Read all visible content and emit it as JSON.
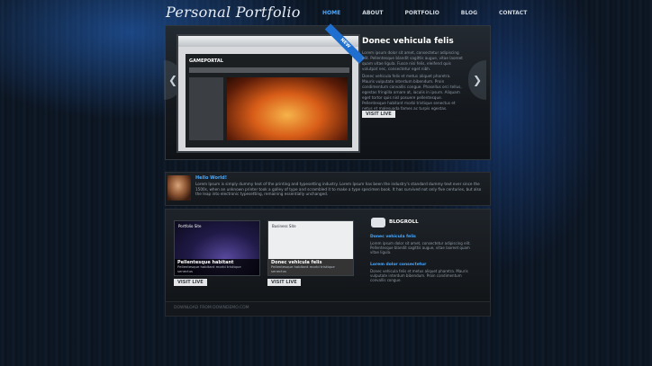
{
  "site": {
    "logo": "Personal Portfolio"
  },
  "nav": {
    "items": [
      "HOME",
      "ABOUT",
      "PORTFOLIO",
      "BLOG",
      "CONTACT"
    ],
    "active": "HOME"
  },
  "featured": {
    "ribbon": "NEW",
    "screenshot_logo": "GAMEPORTAL",
    "title": "Donec vehicula felis",
    "paragraph1": "Lorem ipsum dolor sit amet, consectetur adipiscing elit. Pellentesque blandit sagittis augue, vitae laoreet quam vitae ligula. Fusce nisi felis, eleifend quis volutpat nec, consectetur eget nibh.",
    "paragraph2": "Donec vehicula felis et metus aliquet pharetra. Mauris vulputate interdum bibendum. Proin condimentum convallis congue. Phasellus orci tellus, egestas fringilla ornare at, iaculis in ipsum. Aliquam eget tortor quis nisl posuere pellentesque. Pellentesque habitant morbi tristique senectus et netus et malesuada fames ac turpis egestas.",
    "button": "VISIT LIVE"
  },
  "hello": {
    "title": "Hello World!",
    "text": "Lorem Ipsum is simply dummy text of the printing and typesetting industry. Lorem Ipsum has been the industry's standard dummy text ever since the 1500s, when an unknown printer took a galley of type and scrambled it to make a type specimen book. It has survived not only five centuries, but also the leap into electronic typesetting, remaining essentially unchanged."
  },
  "portfolio_cards": [
    {
      "thumb_label": "Portfolio Site",
      "title": "Pellentesque habitant",
      "subtitle": "Pellentesque habitant morbi tristique senectus",
      "button": "VISIT LIVE"
    },
    {
      "thumb_label": "Business Site",
      "title": "Donec vehicula felis",
      "subtitle": "Pellentesque habitant morbi tristique senectus",
      "button": "VISIT LIVE"
    }
  ],
  "blogroll": {
    "heading": "BLOGROLL",
    "posts": [
      {
        "title": "Donec vehicula felis",
        "text": "Lorem ipsum dolor sit amet, consectetur adipiscing elit. Pellentesque blandit sagittis augue, vitae laoreet quam vitae ligula."
      },
      {
        "title": "Lorem dolor consectetur",
        "text": "Donec vehicula felis et metus aliquet pharetra. Mauris vulputate interdum bibendum. Proin condimentum convallis congue."
      }
    ]
  },
  "footer": {
    "text": "DOWNLOAD FROM DOWNDEMO.COM"
  },
  "colors": {
    "accent": "#49a9ff",
    "ribbon": "#1f6fd0",
    "background": "#07101c"
  }
}
